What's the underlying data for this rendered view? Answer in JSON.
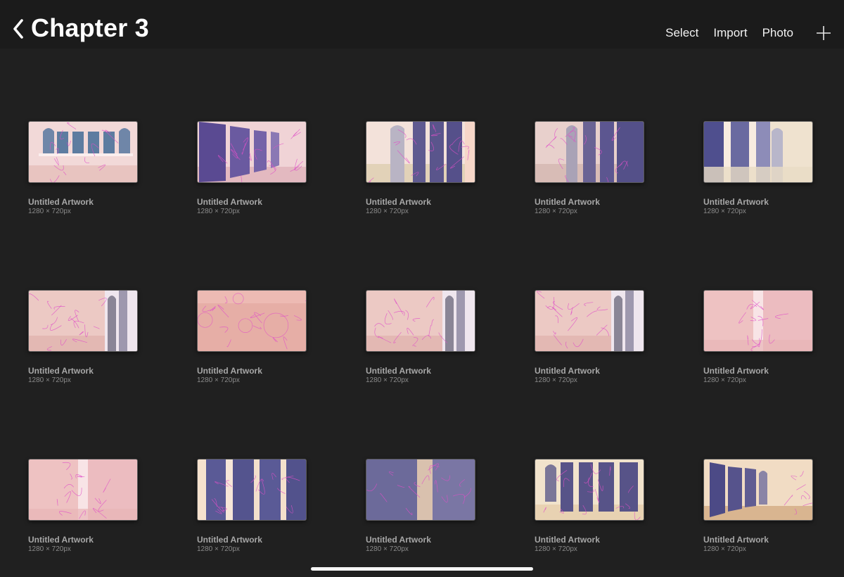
{
  "header": {
    "title": "Chapter 3",
    "back_icon": "chevron-left-icon",
    "actions": [
      "Select",
      "Import",
      "Photo"
    ],
    "add_icon": "plus-icon"
  },
  "artworks": [
    {
      "name": "Untitled Artwork",
      "size": "1280 × 720px",
      "scene": "pink-room-windows"
    },
    {
      "name": "Untitled Artwork",
      "size": "1280 × 720px",
      "scene": "purple-windows-left"
    },
    {
      "name": "Untitled Artwork",
      "size": "1280 × 720px",
      "scene": "windows-sketch"
    },
    {
      "name": "Untitled Artwork",
      "size": "1280 × 720px",
      "scene": "windows-sketch-dim"
    },
    {
      "name": "Untitled Artwork",
      "size": "1280 × 720px",
      "scene": "purple-blue-light"
    },
    {
      "name": "Untitled Artwork",
      "size": "1280 × 720px",
      "scene": "pink-sketch-arch"
    },
    {
      "name": "Untitled Artwork",
      "size": "1280 × 720px",
      "scene": "salmon-sketch"
    },
    {
      "name": "Untitled Artwork",
      "size": "1280 × 720px",
      "scene": "pink-sketch-arch"
    },
    {
      "name": "Untitled Artwork",
      "size": "1280 × 720px",
      "scene": "pink-sketch-arch"
    },
    {
      "name": "Untitled Artwork",
      "size": "1280 × 720px",
      "scene": "pink-figure-light"
    },
    {
      "name": "Untitled Artwork",
      "size": "1280 × 720px",
      "scene": "pink-figure-light"
    },
    {
      "name": "Untitled Artwork",
      "size": "1280 × 720px",
      "scene": "blue-windows-cream"
    },
    {
      "name": "Untitled Artwork",
      "size": "1280 × 720px",
      "scene": "lavender-light"
    },
    {
      "name": "Untitled Artwork",
      "size": "1280 × 720px",
      "scene": "cream-windows-figure"
    },
    {
      "name": "Untitled Artwork",
      "size": "1280 × 720px",
      "scene": "cream-windows-left"
    }
  ],
  "colors": {
    "background": "#202020",
    "topbar": "#1b1b1b",
    "title_text": "#ffffff",
    "card_name": "#a7a7a7",
    "card_size": "#8a8a8a",
    "sketch_line": "#e04fc8"
  }
}
